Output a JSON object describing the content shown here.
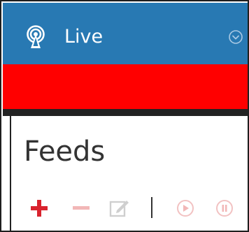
{
  "header": {
    "title": "Live",
    "icon": "broadcast-icon",
    "collapse_icon": "chevron-down-circle-icon",
    "background": "#2879b3"
  },
  "alert_band": {
    "color": "#ff0000"
  },
  "feeds": {
    "title": "Feeds",
    "toolbar": {
      "add": {
        "icon": "plus-icon",
        "color": "#d9232e",
        "enabled": true
      },
      "remove": {
        "icon": "minus-icon",
        "color": "#f2b7b7",
        "enabled": false
      },
      "edit": {
        "icon": "edit-icon",
        "color": "#cfcfcf",
        "enabled": false
      },
      "play": {
        "icon": "play-icon",
        "color": "#f2b7b7",
        "enabled": false
      },
      "pause": {
        "icon": "pause-icon",
        "color": "#f2b7b7",
        "enabled": false
      }
    }
  }
}
